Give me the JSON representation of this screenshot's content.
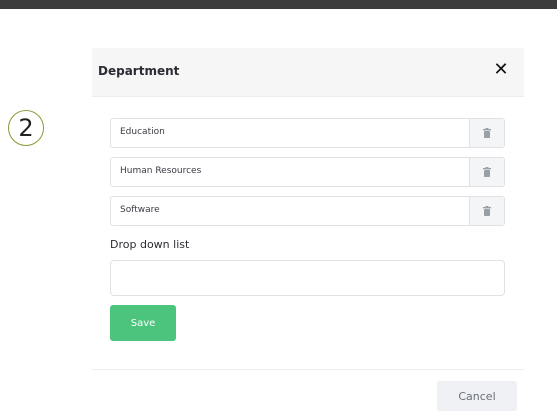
{
  "step_badge": "2",
  "modal": {
    "title": "Department",
    "close_icon": "close-x-icon",
    "departments": [
      {
        "value": "Education",
        "delete_icon": "trash-icon"
      },
      {
        "value": "Human Resources",
        "delete_icon": "trash-icon"
      },
      {
        "value": "Software",
        "delete_icon": "trash-icon"
      }
    ],
    "dropdown_label": "Drop down list",
    "dropdown_value": "",
    "save_label": "Save",
    "cancel_label": "Cancel"
  },
  "colors": {
    "save_button": "#4cc47e",
    "header_bg": "#f6f6f7",
    "top_bar": "#3d3d3d"
  }
}
